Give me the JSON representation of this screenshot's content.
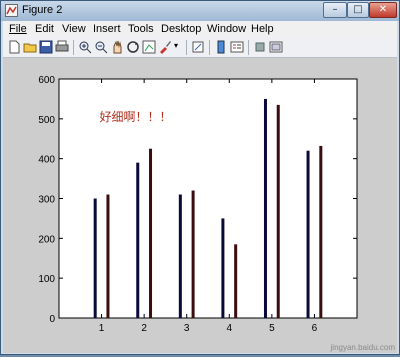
{
  "window": {
    "title": "Figure 2"
  },
  "menu": [
    "File",
    "Edit",
    "View",
    "Insert",
    "Tools",
    "Desktop",
    "Window",
    "Help"
  ],
  "toolbar": {
    "icons": [
      "new-figure-icon",
      "open-file-icon",
      "save-icon",
      "print-icon",
      "zoom-in-icon",
      "zoom-out-icon",
      "pan-icon",
      "rotate-3d-icon",
      "data-cursor-icon",
      "brush-icon",
      "link-icon",
      "colorbar-icon",
      "legend-icon",
      "hide-plot-tools-icon",
      "show-plot-tools-icon"
    ]
  },
  "chart_data": {
    "type": "bar",
    "categories": [
      "1",
      "2",
      "3",
      "4",
      "5",
      "6"
    ],
    "series": [
      {
        "values": [
          300,
          390,
          310,
          250,
          550,
          420
        ],
        "color": "#0a0a3a"
      },
      {
        "values": [
          310,
          425,
          320,
          185,
          535,
          432
        ],
        "color": "#3a0e0e"
      }
    ],
    "ylim": [
      0,
      600
    ],
    "xlim": [
      0,
      7
    ],
    "yticks": [
      0,
      100,
      200,
      300,
      400,
      500,
      600
    ],
    "xticks": [
      "1",
      "2",
      "3",
      "4",
      "5",
      "6"
    ],
    "annotation": "好细啊！！！",
    "annotation_color": "#b03020",
    "grid": false
  },
  "watermark": "jingyan.baidu.com"
}
